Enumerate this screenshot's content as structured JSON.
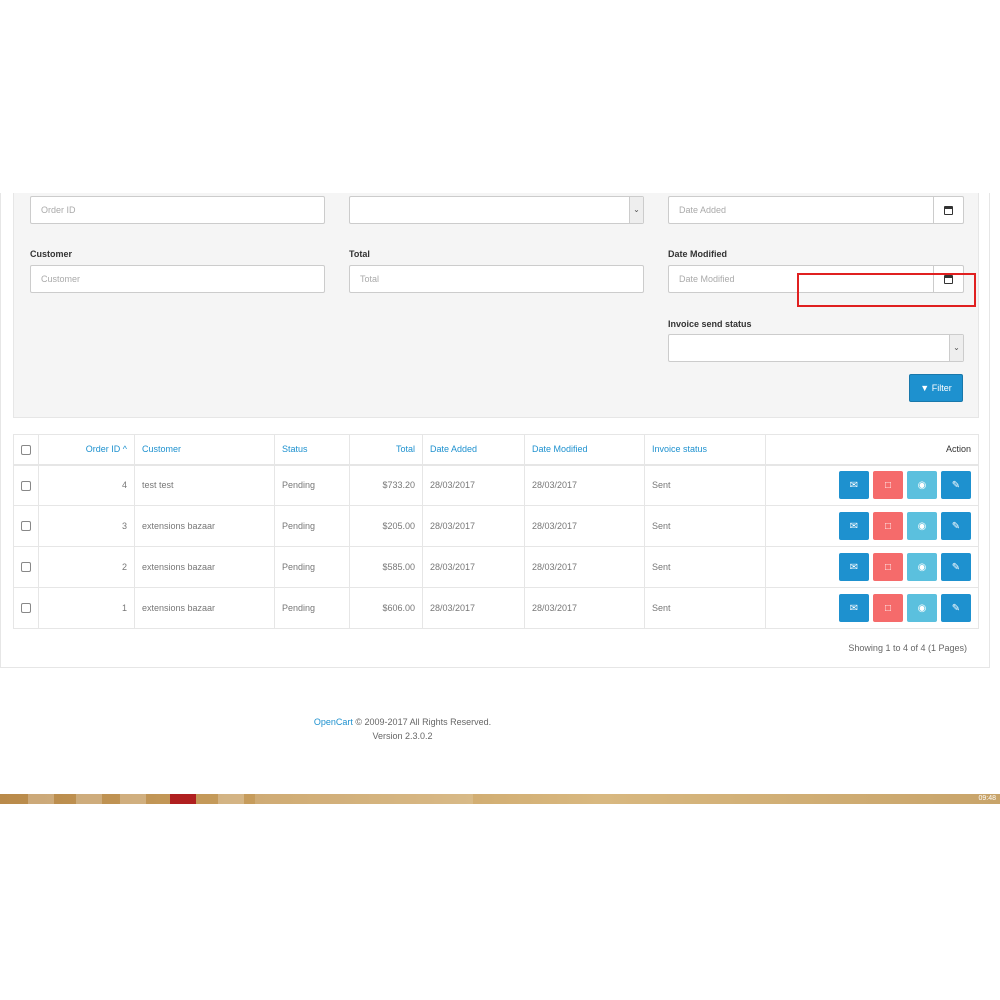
{
  "filters": {
    "order_id_placeholder": "Order ID",
    "date_added_placeholder": "Date Added",
    "customer_label": "Customer",
    "customer_placeholder": "Customer",
    "total_label": "Total",
    "total_placeholder": "Total",
    "date_modified_label": "Date Modified",
    "date_modified_placeholder": "Date Modified",
    "invoice_status_label": "Invoice send status",
    "filter_button": "Filter"
  },
  "table": {
    "columns": {
      "order_id": "Order ID",
      "customer": "Customer",
      "status": "Status",
      "total": "Total",
      "date_added": "Date Added",
      "date_modified": "Date Modified",
      "invoice_status": "Invoice status",
      "action": "Action"
    },
    "rows": [
      {
        "order_id": "4",
        "customer": "test test",
        "status": "Pending",
        "total": "$733.20",
        "date_added": "28/03/2017",
        "date_modified": "28/03/2017",
        "invoice_status": "Sent"
      },
      {
        "order_id": "3",
        "customer": "extensions bazaar",
        "status": "Pending",
        "total": "$205.00",
        "date_added": "28/03/2017",
        "date_modified": "28/03/2017",
        "invoice_status": "Sent"
      },
      {
        "order_id": "2",
        "customer": "extensions bazaar",
        "status": "Pending",
        "total": "$585.00",
        "date_added": "28/03/2017",
        "date_modified": "28/03/2017",
        "invoice_status": "Sent"
      },
      {
        "order_id": "1",
        "customer": "extensions bazaar",
        "status": "Pending",
        "total": "$606.00",
        "date_added": "28/03/2017",
        "date_modified": "28/03/2017",
        "invoice_status": "Sent"
      }
    ]
  },
  "pagination": {
    "showing": "Showing 1 to 4 of 4 (1 Pages)"
  },
  "footer": {
    "link": "OpenCart",
    "copyright": "© 2009-2017 All Rights Reserved.",
    "version": "Version 2.3.0.2"
  },
  "taskbar": {
    "clock": "09:48"
  },
  "colors": {
    "primary": "#1e91cf",
    "danger": "#f56b6b",
    "info": "#5bc0de",
    "highlight": "#e02020"
  }
}
